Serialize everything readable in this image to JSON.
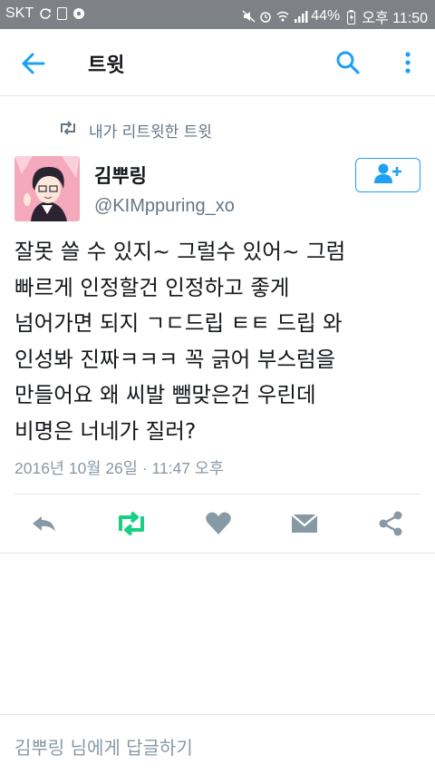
{
  "status_bar": {
    "carrier": "SKT",
    "battery": "44%",
    "time": "오후 11:50"
  },
  "app_bar": {
    "title": "트윗",
    "icons": [
      "back-arrow-icon",
      "search-icon",
      "more-vert-icon"
    ]
  },
  "retweet_context": "내가 리트윗한 트윗",
  "tweet": {
    "author_name": "김뿌링",
    "author_handle": "@KIMppuring_xo",
    "text": "잘못 쓸 수 있지~ 그럴수 있어~ 그럼\n빠르게 인정할건 인정하고 좋게\n넘어가면 되지 ㄱㄷ드립 ㅌㅌ 드립 와\n인성봐 진짜ㅋㅋㅋ 꼭 긁어 부스럼을\n만들어요 왜 씨발 뺌맞은건 우린데\n비명은 너네가 질러?",
    "timestamp": "2016년 10월 26일 · 11:47 오후",
    "retweeted": true
  },
  "actions": [
    "reply-icon",
    "retweet-icon",
    "like-icon",
    "dm-icon",
    "share-icon"
  ],
  "reply_placeholder": "김뿌링 님에게 답글하기",
  "colors": {
    "accent": "#1da1f2",
    "retweet_green": "#19cf86",
    "muted": "#8899a6",
    "status_bar": "#7e8287"
  }
}
